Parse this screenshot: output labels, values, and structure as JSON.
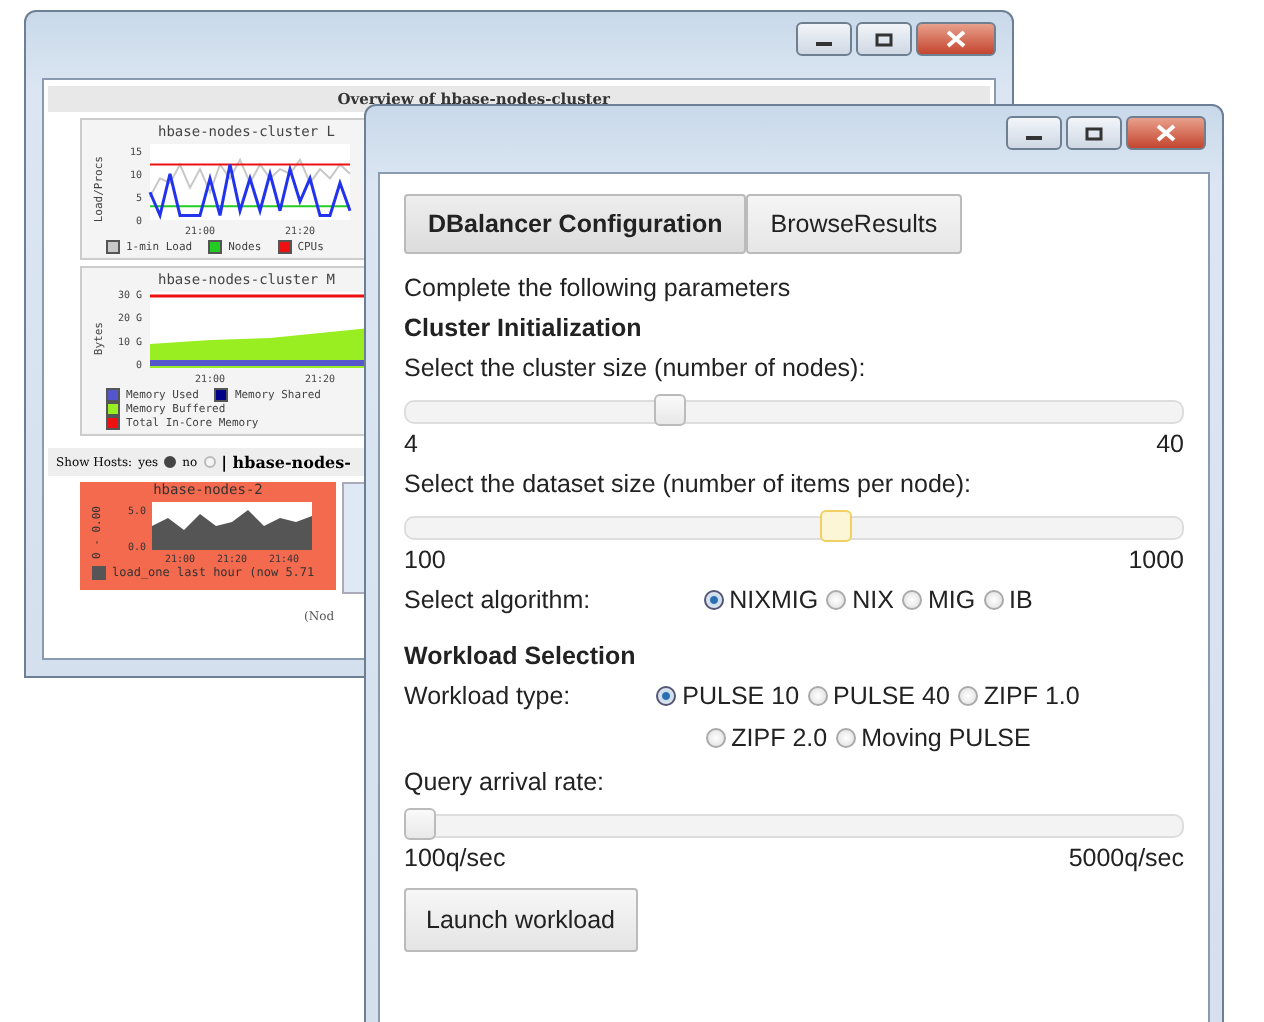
{
  "background_window": {
    "heading": "Overview of hbase-nodes-cluster",
    "graphs": [
      {
        "title": "hbase-nodes-cluster L",
        "y_label": "Load/Procs",
        "chart_data": {
          "type": "line",
          "x": [
            1250,
            1252,
            1254,
            1256,
            1258,
            1260,
            1262,
            1264,
            1266,
            1268,
            1270,
            1272,
            1274,
            1276,
            1278,
            1280,
            1282,
            1284,
            1286,
            1288,
            1290
          ],
          "xlim": [
            1250,
            1290
          ],
          "ylim": [
            0,
            16
          ],
          "xticks": [
            {
              "value": 1260,
              "label": "21:00"
            },
            {
              "value": 1280,
              "label": "21:20"
            }
          ],
          "yticks": [
            0,
            5,
            10,
            15
          ],
          "series": [
            {
              "name": "1-min Load",
              "color": "#c8c8c8",
              "values": [
                5,
                9,
                8,
                12,
                7,
                11,
                6,
                12,
                9,
                13,
                8,
                12,
                9,
                11,
                10,
                13,
                8,
                11,
                9,
                12,
                10
              ]
            },
            {
              "name": "Nodes",
              "color": "#22cc22",
              "values": [
                3,
                3,
                3,
                3,
                3,
                3,
                3,
                3,
                3,
                3,
                3,
                3,
                3,
                3,
                3,
                3,
                3,
                3,
                3,
                3,
                3
              ]
            },
            {
              "name": "CPUs",
              "color": "#ee1111",
              "values": [
                12,
                12,
                12,
                12,
                12,
                12,
                12,
                12,
                12,
                12,
                12,
                12,
                12,
                12,
                12,
                12,
                12,
                12,
                12,
                12,
                12
              ]
            },
            {
              "color": "#2233ee",
              "values": [
                6,
                1,
                10,
                1,
                1,
                1,
                9,
                1,
                12,
                2,
                9,
                2,
                10,
                2,
                11,
                4,
                9,
                1,
                1,
                8,
                2
              ]
            }
          ]
        }
      },
      {
        "kind": "memory",
        "title": "hbase-nodes-cluster M",
        "y_label": "Bytes",
        "y_ticks": [
          "30 G",
          "20 G",
          "10 G",
          "0"
        ],
        "x_ticks": [
          "21:00",
          "21:20"
        ],
        "legend": [
          {
            "label": "Memory Used",
            "color": "#5555cc"
          },
          {
            "label": "Memory Shared",
            "color": "#000088"
          },
          {
            "label": "Memory Buffered",
            "color": "#99ee22"
          },
          {
            "label": "Total In-Core Memory",
            "color": "#ee1111"
          }
        ]
      }
    ],
    "hosts_bar": {
      "label": "Show Hosts:",
      "options": [
        {
          "label": "yes",
          "selected": true
        },
        {
          "label": "no",
          "selected": false
        }
      ],
      "cluster_link": "| hbase-nodes-"
    },
    "host_tiles": [
      {
        "title": "hbase-nodes-2",
        "y_label": "0 - 0.00",
        "y_ticks": [
          "5.0",
          "0.0"
        ],
        "x_ticks": [
          "21:00",
          "21:20",
          "21:40"
        ],
        "caption": "load_one last hour (now 5.71"
      }
    ],
    "footer": "(Nod"
  },
  "dialog": {
    "tabs": [
      {
        "label": "DBalancer Configuration",
        "selected": true
      },
      {
        "label": "BrowseResults",
        "selected": false
      }
    ],
    "intro": "Complete the following parameters",
    "sections": [
      {
        "title": "Cluster Initialization",
        "rows": [
          {
            "kind": "slider",
            "label": "Select the cluster size (number of nodes):",
            "level": 0.335,
            "focused": false,
            "min": "4",
            "max": "40"
          },
          {
            "kind": "slider",
            "label": "Select the dataset size (number of items per node):",
            "level": 0.555,
            "focused": true,
            "min": "100",
            "max": "1000"
          },
          {
            "kind": "radio",
            "label": "Select algorithm:",
            "options": [
              {
                "label": "NIXMIG",
                "selected": true
              },
              {
                "label": "NIX",
                "selected": false
              },
              {
                "label": "MIG",
                "selected": false
              },
              {
                "label": "IB",
                "selected": false
              }
            ]
          }
        ]
      },
      {
        "title": "Workload Selection",
        "rows": [
          {
            "kind": "radio",
            "label": "Workload type:",
            "options": [
              {
                "label": "PULSE 10",
                "selected": true
              },
              {
                "label": "PULSE 40",
                "selected": false
              },
              {
                "label": "ZIPF 1.0",
                "selected": false
              },
              {
                "label": "ZIPF 2.0",
                "selected": false
              },
              {
                "label": "Moving PULSE",
                "selected": false
              }
            ]
          },
          {
            "kind": "slider",
            "label": "Query arrival rate:",
            "level": 0,
            "focused": false,
            "min": "100q/sec",
            "max": "5000q/sec"
          }
        ]
      }
    ],
    "button": "Launch workload"
  }
}
